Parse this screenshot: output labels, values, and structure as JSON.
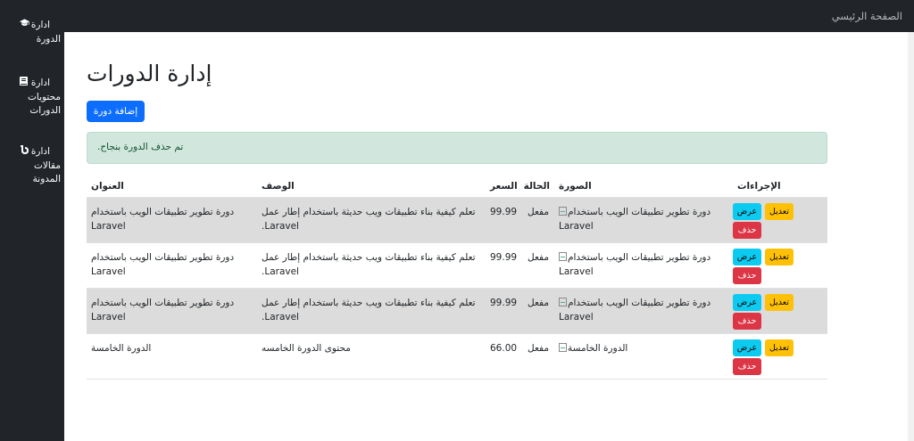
{
  "topbar": {
    "home_link": "الصفحة الرئيسي"
  },
  "sidebar": {
    "items": [
      {
        "icon": "graduation-cap-icon",
        "line1": "ادارة",
        "line2": "الدورة"
      },
      {
        "icon": "book-icon",
        "line1": "ادارة",
        "line2": "محتويات الدورات"
      },
      {
        "icon": "blog-icon",
        "line1": "ادارة",
        "line2": "مقالات المدونة"
      }
    ]
  },
  "main": {
    "title": "إدارة الدورات",
    "add_button": "إضافة دورة",
    "alert": "تم حذف الدورة بنجاح.",
    "table": {
      "headers": {
        "title": "العنوان",
        "description": "الوصف",
        "price": "السعر",
        "status": "الحالة",
        "image": "الصورة",
        "actions": "الإجراءات"
      },
      "rows": [
        {
          "title": "دورة تطوير تطبيقات الويب باستخدام Laravel",
          "description": "تعلم كيفية بناء تطبيقات ويب حديثة باستخدام إطار عمل Laravel.",
          "price": "99.99",
          "status": "مفعل",
          "image_alt": "دورة تطوير تطبيقات الويب باستخدام Laravel"
        },
        {
          "title": "دورة تطوير تطبيقات الويب باستخدام Laravel",
          "description": "تعلم كيفية بناء تطبيقات ويب حديثة باستخدام إطار عمل Laravel.",
          "price": "99.99",
          "status": "مفعل",
          "image_alt": "دورة تطوير تطبيقات الويب باستخدام Laravel"
        },
        {
          "title": "دورة تطوير تطبيقات الويب باستخدام Laravel",
          "description": "تعلم كيفية بناء تطبيقات ويب حديثة باستخدام إطار عمل Laravel.",
          "price": "99.99",
          "status": "مفعل",
          "image_alt": "دورة تطوير تطبيقات الويب باستخدام Laravel"
        },
        {
          "title": "الدورة الخامسة",
          "description": "محتوى الدورة الخامسه",
          "price": "66.00",
          "status": "مفعل",
          "image_alt": "الدورة الخامسة"
        }
      ],
      "actions": {
        "view": "عرض",
        "edit": "تعديل",
        "delete": "حذف"
      }
    }
  },
  "colors": {
    "sidebar_bg": "#212529",
    "primary": "#0d6efd",
    "info": "#0dcaf0",
    "warning": "#ffc107",
    "danger": "#dc3545",
    "alert_bg": "#d1e7dd",
    "row_stripe": "#dcdcdc"
  }
}
